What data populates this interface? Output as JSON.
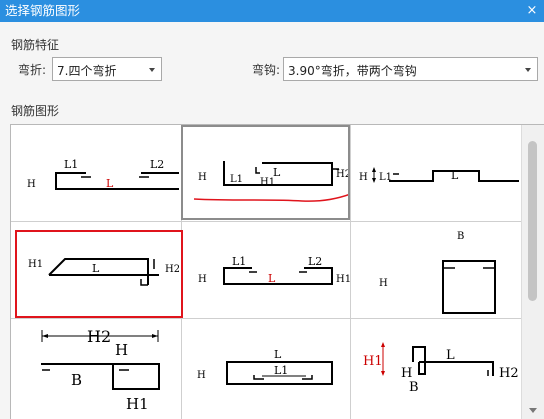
{
  "window": {
    "title": "选择钢筋图形",
    "close_icon": "×"
  },
  "features": {
    "section_label": "钢筋特征",
    "bend_label": "弯折:",
    "bend_value": "7.四个弯折",
    "hook_label": "弯钩:",
    "hook_value": "3.90°弯折，带两个弯钩"
  },
  "shapes": {
    "section_label": "钢筋图形",
    "selected_color": "#e0141c",
    "label_color_red": "#cc0000",
    "items": [
      {
        "labels": [
          "L1",
          "L2",
          "H",
          "L"
        ]
      },
      {
        "labels": [
          "H",
          "L",
          "L1",
          "H1",
          "H2"
        ]
      },
      {
        "labels": [
          "H",
          "L1",
          "L"
        ]
      },
      {
        "labels": [
          "H1",
          "L",
          "H2"
        ]
      },
      {
        "labels": [
          "H",
          "L1",
          "L2",
          "L",
          "H1"
        ]
      },
      {
        "labels": [
          "B",
          "H"
        ]
      },
      {
        "labels": [
          "H2",
          "H",
          "B",
          "H1"
        ]
      },
      {
        "labels": [
          "L",
          "H",
          "L1"
        ]
      },
      {
        "labels": [
          "H1",
          "L",
          "H",
          "B",
          "H2"
        ]
      }
    ]
  }
}
